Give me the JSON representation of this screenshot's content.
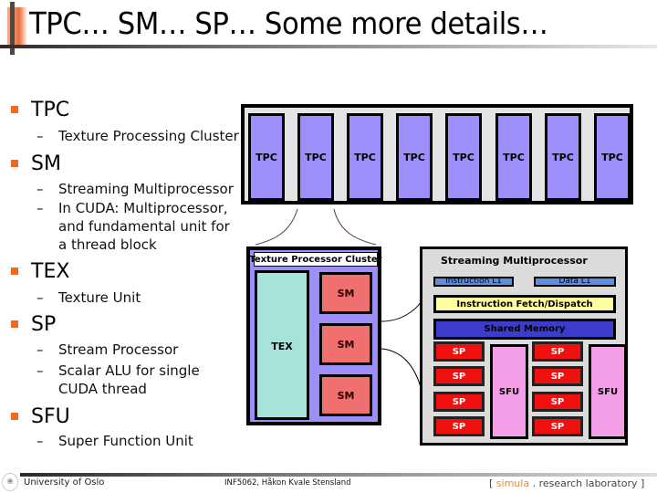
{
  "slide": {
    "title": "TPC… SM… SP… Some more details…"
  },
  "bullets": [
    {
      "term": "TPC",
      "subs": [
        "Texture Processing Cluster"
      ]
    },
    {
      "term": "SM",
      "subs": [
        "Streaming Multiprocessor",
        "In CUDA: Multiprocessor,",
        "and fundamental unit for",
        "a thread block"
      ]
    },
    {
      "term": "TEX",
      "subs": [
        "Texture Unit"
      ]
    },
    {
      "term": "SP",
      "subs": [
        "Stream Processor",
        "Scalar ALU for single",
        "CUDA thread"
      ]
    },
    {
      "term": "SFU",
      "subs": [
        "Super Function Unit"
      ]
    }
  ],
  "diagram": {
    "tpc_array": {
      "tpc_labels": [
        "TPC",
        "TPC",
        "TPC",
        "TPC",
        "TPC",
        "TPC",
        "TPC",
        "TPC"
      ]
    },
    "texture_processor_cluster": {
      "label": "Texture Processor Cluster",
      "tex_label": "TEX",
      "sm_labels": [
        "SM",
        "SM",
        "SM"
      ]
    },
    "streaming_multiprocessor": {
      "label": "Streaming Multiprocessor",
      "instruction_cache": "Instruction L1",
      "data_cache": "Data L1",
      "fetch_dispatch": "Instruction Fetch/Dispatch",
      "shared_memory": "Shared Memory",
      "sp_labels_left": [
        "SP",
        "SP",
        "SP",
        "SP"
      ],
      "sp_labels_right": [
        "SP",
        "SP",
        "SP",
        "SP"
      ],
      "sfu_labels": [
        "SFU",
        "SFU"
      ]
    },
    "colors": {
      "tpc": "#9c8ff9",
      "tex": "#a6e4da",
      "sm": "#f07070",
      "sp": "#f01010",
      "sfu": "#f49ee8",
      "fetch_dispatch": "#fffe9e",
      "shared_memory": "#3b3bcc",
      "cache": "#5c8de0",
      "bullet": "#ed6a1e"
    }
  },
  "footer": {
    "institution": "University of Oslo",
    "course": "INF5062, Håkon Kvale Stensland",
    "lab_open": "[ ",
    "lab_brand": "simula",
    "lab_rest": " . research laboratory ]"
  }
}
